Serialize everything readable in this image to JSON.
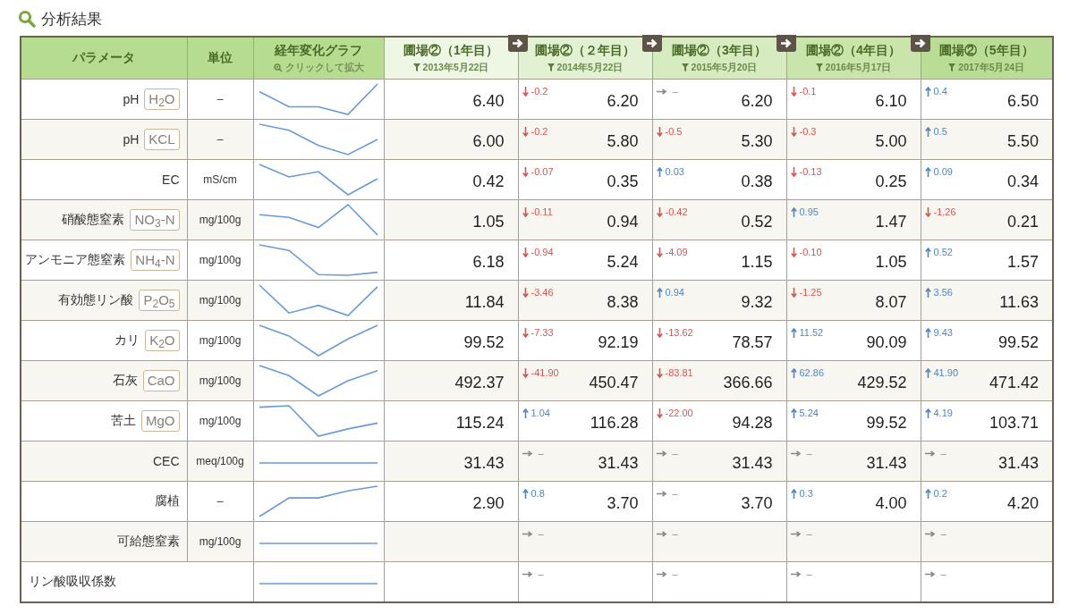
{
  "title": "分析結果",
  "table": {
    "columns": [
      {
        "label": "パラメータ"
      },
      {
        "label": "単位"
      },
      {
        "label": "経年変化グラフ",
        "hint": "クリックして拡大"
      }
    ],
    "years": [
      {
        "label": "圃場②（1年目）",
        "date": "2013年5月22日"
      },
      {
        "label": "圃場②（２年目）",
        "date": "2014年5月22日"
      },
      {
        "label": "圃場②（3年目）",
        "date": "2015年5月20日"
      },
      {
        "label": "圃場②（4年目）",
        "date": "2016年5月17日"
      },
      {
        "label": "圃場②（5年目）",
        "date": "2017年5月24日"
      }
    ],
    "rows": [
      {
        "name": "pH",
        "formula": "H$_{2}$O",
        "unit": "–",
        "first": "6.40",
        "changes": [
          {
            "kind": "down",
            "change": "-0.2",
            "value": "6.20"
          },
          {
            "kind": "flat",
            "change": "–",
            "value": "6.20"
          },
          {
            "kind": "down",
            "change": "-0.1",
            "value": "6.10"
          },
          {
            "kind": "up",
            "change": "0.4",
            "value": "6.50"
          }
        ]
      },
      {
        "name": "pH",
        "formula": "KCL",
        "unit": "–",
        "first": "6.00",
        "changes": [
          {
            "kind": "down",
            "change": "-0.2",
            "value": "5.80"
          },
          {
            "kind": "down",
            "change": "-0.5",
            "value": "5.30"
          },
          {
            "kind": "down",
            "change": "-0.3",
            "value": "5.00"
          },
          {
            "kind": "up",
            "change": "0.5",
            "value": "5.50"
          }
        ]
      },
      {
        "name": "EC",
        "unit": "mS/cm",
        "first": "0.42",
        "changes": [
          {
            "kind": "down",
            "change": "-0.07",
            "value": "0.35"
          },
          {
            "kind": "up",
            "change": "0.03",
            "value": "0.38"
          },
          {
            "kind": "down",
            "change": "-0.13",
            "value": "0.25"
          },
          {
            "kind": "up",
            "change": "0.09",
            "value": "0.34"
          }
        ]
      },
      {
        "name": "硝酸態窒素",
        "formula": "NO$_{3}$-N",
        "unit": "mg/100g",
        "first": "1.05",
        "changes": [
          {
            "kind": "down",
            "change": "-0.11",
            "value": "0.94"
          },
          {
            "kind": "down",
            "change": "-0.42",
            "value": "0.52"
          },
          {
            "kind": "up",
            "change": "0.95",
            "value": "1.47"
          },
          {
            "kind": "down",
            "change": "-1.26",
            "value": "0.21"
          }
        ]
      },
      {
        "name": "アンモニア態窒素",
        "formula": "NH$_{4}$-N",
        "unit": "mg/100g",
        "first": "6.18",
        "changes": [
          {
            "kind": "down",
            "change": "-0.94",
            "value": "5.24"
          },
          {
            "kind": "down",
            "change": "-4.09",
            "value": "1.15"
          },
          {
            "kind": "down",
            "change": "-0.10",
            "value": "1.05"
          },
          {
            "kind": "up",
            "change": "0.52",
            "value": "1.57"
          }
        ]
      },
      {
        "name": "有効態リン酸",
        "formula": "P$_{2}$O$_{5}$",
        "unit": "mg/100g",
        "first": "11.84",
        "changes": [
          {
            "kind": "down",
            "change": "-3.46",
            "value": "8.38"
          },
          {
            "kind": "up",
            "change": "0.94",
            "value": "9.32"
          },
          {
            "kind": "down",
            "change": "-1.25",
            "value": "8.07"
          },
          {
            "kind": "up",
            "change": "3.56",
            "value": "11.63"
          }
        ]
      },
      {
        "name": "カリ",
        "formula": "K$_{2}$O",
        "unit": "mg/100g",
        "first": "99.52",
        "changes": [
          {
            "kind": "down",
            "change": "-7.33",
            "value": "92.19"
          },
          {
            "kind": "down",
            "change": "-13.62",
            "value": "78.57"
          },
          {
            "kind": "up",
            "change": "11.52",
            "value": "90.09"
          },
          {
            "kind": "up",
            "change": "9.43",
            "value": "99.52"
          }
        ]
      },
      {
        "name": "石灰",
        "formula": "CaO",
        "unit": "mg/100g",
        "first": "492.37",
        "changes": [
          {
            "kind": "down",
            "change": "-41.90",
            "value": "450.47"
          },
          {
            "kind": "down",
            "change": "-83.81",
            "value": "366.66"
          },
          {
            "kind": "up",
            "change": "62.86",
            "value": "429.52"
          },
          {
            "kind": "up",
            "change": "41.90",
            "value": "471.42"
          }
        ]
      },
      {
        "name": "苦土",
        "formula": "MgO",
        "unit": "mg/100g",
        "first": "115.24",
        "changes": [
          {
            "kind": "up",
            "change": "1.04",
            "value": "116.28"
          },
          {
            "kind": "down",
            "change": "-22.00",
            "value": "94.28"
          },
          {
            "kind": "up",
            "change": "5.24",
            "value": "99.52"
          },
          {
            "kind": "up",
            "change": "4.19",
            "value": "103.71"
          }
        ]
      },
      {
        "name": "CEC",
        "unit": "meq/100g",
        "first": "31.43",
        "changes": [
          {
            "kind": "flat",
            "change": "–",
            "value": "31.43"
          },
          {
            "kind": "flat",
            "change": "–",
            "value": "31.43"
          },
          {
            "kind": "flat",
            "change": "–",
            "value": "31.43"
          },
          {
            "kind": "flat",
            "change": "–",
            "value": "31.43"
          }
        ]
      },
      {
        "name": "腐植",
        "unit": "–",
        "first": "2.90",
        "changes": [
          {
            "kind": "up",
            "change": "0.8",
            "value": "3.70"
          },
          {
            "kind": "flat",
            "change": "–",
            "value": "3.70"
          },
          {
            "kind": "up",
            "change": "0.3",
            "value": "4.00"
          },
          {
            "kind": "up",
            "change": "0.2",
            "value": "4.20"
          }
        ]
      },
      {
        "name": "可給態窒素",
        "unit": "mg/100g",
        "changes": [
          {
            "kind": "flat",
            "change": "–"
          },
          {
            "kind": "flat",
            "change": "–"
          },
          {
            "kind": "flat",
            "change": "–"
          },
          {
            "kind": "flat",
            "change": "–"
          }
        ]
      },
      {
        "name": "リン酸吸収係数",
        "changes": [
          {
            "kind": "flat",
            "change": "–"
          },
          {
            "kind": "flat",
            "change": "–"
          },
          {
            "kind": "flat",
            "change": "–"
          },
          {
            "kind": "flat",
            "change": "–"
          }
        ]
      }
    ]
  }
}
